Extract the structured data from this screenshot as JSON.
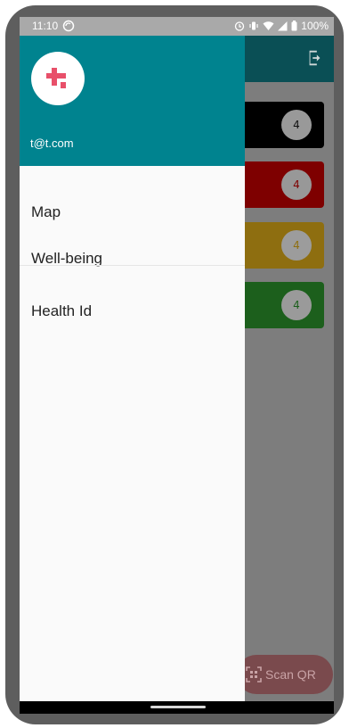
{
  "status_bar": {
    "time": "11:10",
    "battery": "100%"
  },
  "app": {
    "cards": [
      {
        "count": "4",
        "color": "#000000",
        "badge_color": "#999999",
        "text_color": "#111111"
      },
      {
        "count": "4",
        "color": "#7e0000",
        "badge_color": "#989898",
        "text_color": "#7e0000"
      },
      {
        "count": "4",
        "color": "#8e6e10",
        "badge_color": "#9c9c9c",
        "text_color": "#8e6e10"
      },
      {
        "count": "4",
        "color": "#1c5f1c",
        "badge_color": "#9a9a9a",
        "text_color": "#1c5f1c"
      }
    ],
    "fab_label": "Scan QR",
    "appbar_color": "#0a4f55",
    "icons": [
      "logout-icon",
      "qr-scan-icon"
    ]
  },
  "drawer": {
    "header_color": "#00838f",
    "email": "t@t.com",
    "items": [
      {
        "label": "Map"
      },
      {
        "label": "Well-being"
      },
      {
        "label": "Health Id"
      }
    ],
    "icons": [
      "medical-cross-icon"
    ]
  }
}
